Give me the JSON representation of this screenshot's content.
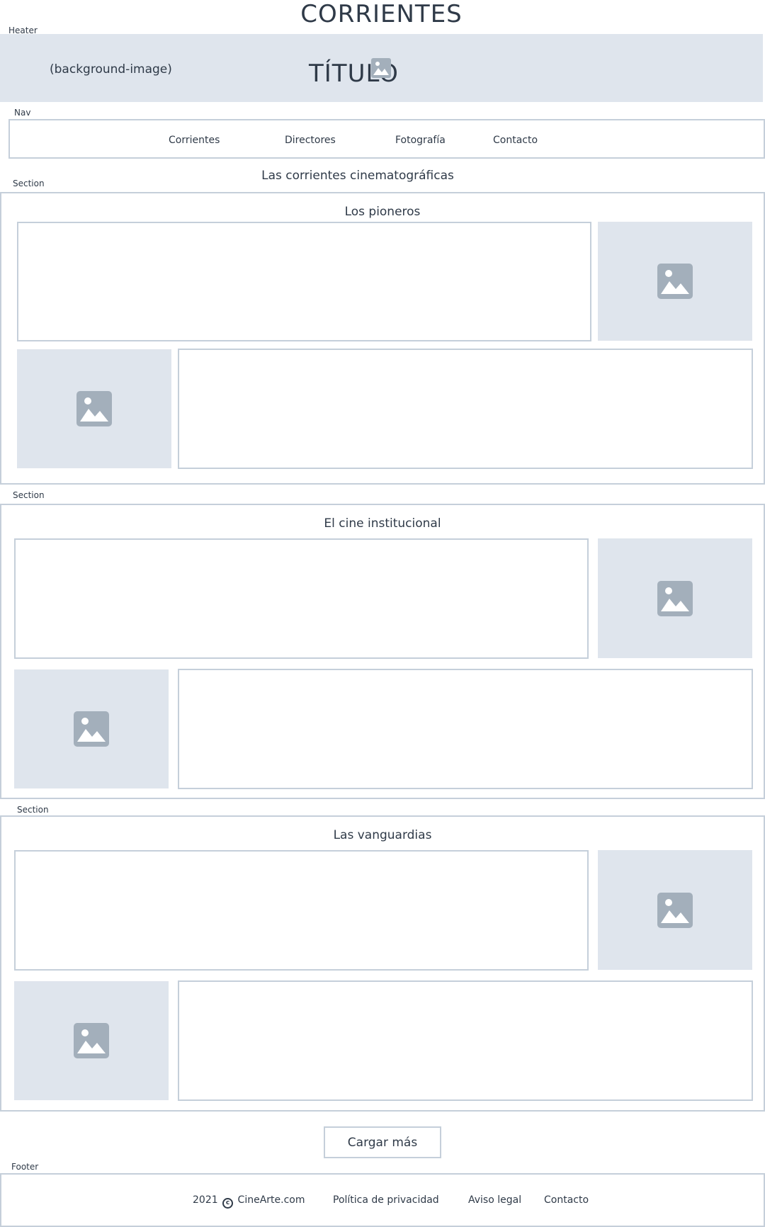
{
  "page": {
    "title": "CORRIENTES"
  },
  "annotations": {
    "header": "Heater",
    "nav": "Nav",
    "section": "Section",
    "footer": "Footer"
  },
  "hero": {
    "background_label": "(background-image)",
    "title": "TÍTULO",
    "icon": "image-icon"
  },
  "nav": {
    "items": [
      {
        "label": "Corrientes"
      },
      {
        "label": "Directores"
      },
      {
        "label": "Fotografía"
      },
      {
        "label": "Contacto"
      }
    ]
  },
  "main": {
    "heading": "Las corrientes cinematográficas"
  },
  "sections": [
    {
      "title": "Los pioneros"
    },
    {
      "title": "El cine institucional"
    },
    {
      "title": "Las vanguardias"
    }
  ],
  "actions": {
    "load_more": "Cargar más"
  },
  "footer": {
    "year": "2021",
    "copyright_icon": "copyright-icon",
    "site": "CineArte.com",
    "links": [
      {
        "label": "Política de privacidad"
      },
      {
        "label": "Aviso legal"
      },
      {
        "label": "Contacto"
      }
    ]
  },
  "colors": {
    "text": "#2f3a48",
    "placeholder_bg": "#dfe5ed",
    "border": "#c5cfda",
    "icon": "#a3afbb"
  }
}
